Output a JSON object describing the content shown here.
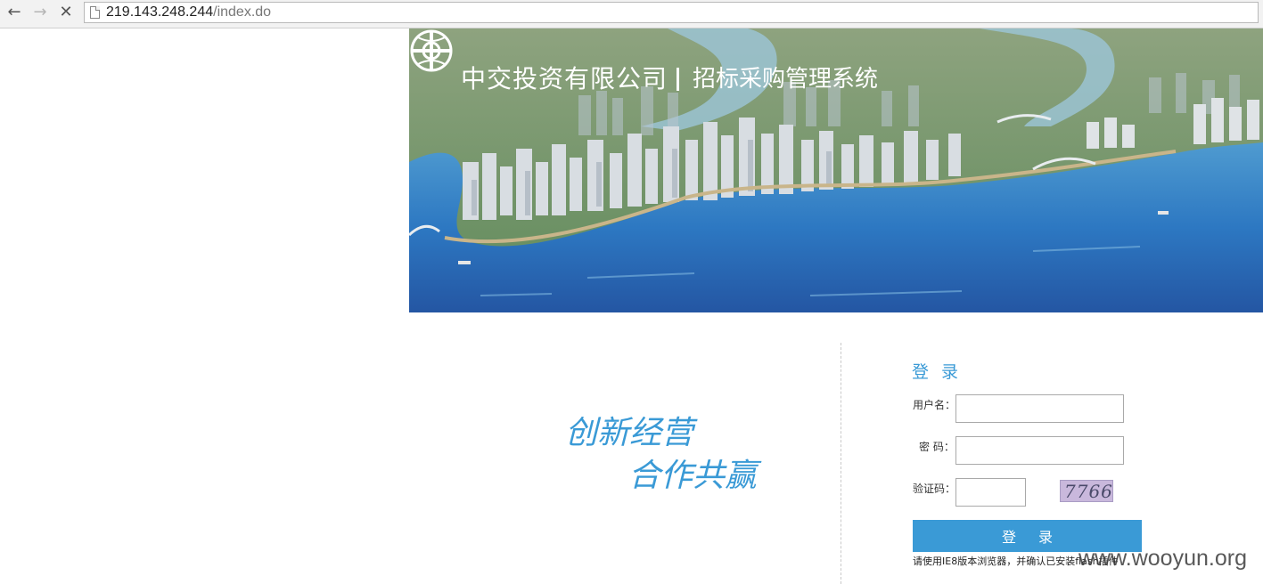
{
  "browser": {
    "url_host": "219.143.248.244",
    "url_path": "/index.do"
  },
  "banner": {
    "company": "中交投资有限公司",
    "system": "招标采购管理系统"
  },
  "slogan": {
    "line1": "创新经营",
    "line2": "合作共赢"
  },
  "login": {
    "title": "登 录",
    "username_label": "用户名：",
    "username_value": "",
    "password_label": "密  码：",
    "password_value": "",
    "captcha_label": "验证码：",
    "captcha_value": "",
    "captcha_image_text": "7766",
    "submit_label": "登 录",
    "notice": "请使用IE8版本浏览器，并确认已安装flash插件"
  },
  "watermark": "www.wooyun.org",
  "colors": {
    "accent": "#3a9ad6"
  }
}
